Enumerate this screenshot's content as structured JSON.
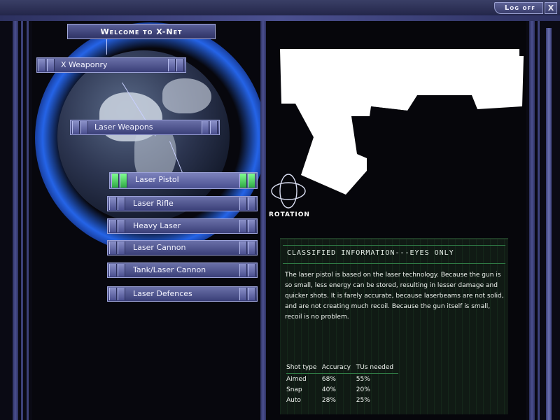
{
  "topbar": {
    "logoff_label": "Log off",
    "close_label": "X"
  },
  "welcome_label": "Welcome to X-Net",
  "nav": {
    "category": "X Weaponry",
    "subcategory": "Laser Weapons",
    "items": [
      {
        "label": "Laser Pistol",
        "active": true
      },
      {
        "label": "Laser Rifle",
        "active": false
      },
      {
        "label": "Heavy Laser",
        "active": false
      },
      {
        "label": "Laser Cannon",
        "active": false
      },
      {
        "label": "Tank/Laser Cannon",
        "active": false
      },
      {
        "label": "Laser Defences",
        "active": false
      }
    ]
  },
  "viewer": {
    "rotation_label": "ROTATION"
  },
  "info": {
    "title": "CLASSIFIED INFORMATION---EYES ONLY",
    "description": "The laser pistol is based on the laser technology. Because the gun is so small, less energy can be stored, resulting in lesser damage and quicker shots. It is farely accurate, because laserbeams are not solid, and are not creating much recoil. Because the gun itself is small, recoil is no problem.",
    "stats_header": {
      "shot_type": "Shot type",
      "accuracy": "Accuracy",
      "tus": "TUs needed"
    },
    "stats": [
      {
        "shot_type": "Aimed",
        "accuracy": "68%",
        "tus": "55%"
      },
      {
        "shot_type": "Snap",
        "accuracy": "40%",
        "tus": "20%"
      },
      {
        "shot_type": "Auto",
        "accuracy": "28%",
        "tus": "25%"
      }
    ]
  },
  "colors": {
    "frame": "#2d3160",
    "button": "#4b5090",
    "active_cap": "#2fa845",
    "info_bg": "#101a14"
  }
}
